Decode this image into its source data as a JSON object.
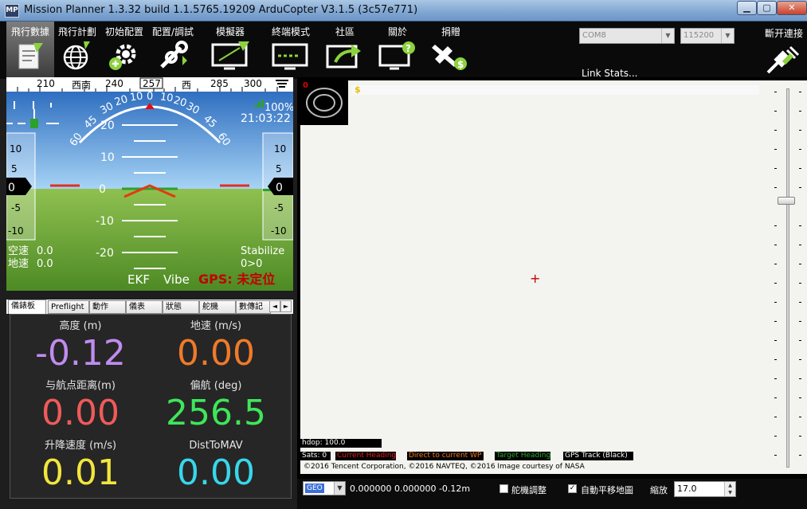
{
  "window": {
    "icon_text": "MP",
    "title": "Mission Planner 1.3.32 build 1.1.5765.19209 ArduCopter V3.1.5 (3c57e771)",
    "min": "▁",
    "max": "▢",
    "close": "✕"
  },
  "menu": [
    {
      "label": "飛行數據",
      "icon": "flight-data-icon"
    },
    {
      "label": "飛行計劃",
      "icon": "flight-plan-globe-icon"
    },
    {
      "label": "初始配置",
      "icon": "initial-setup-gear-icon"
    },
    {
      "label": "配置/調試",
      "icon": "config-tuning-wrench-icon"
    },
    {
      "label": "模擬器",
      "icon": "simulation-monitor-icon"
    },
    {
      "label": "終端模式",
      "icon": "terminal-monitor-icon"
    },
    {
      "label": "社區",
      "icon": "community-share-icon"
    },
    {
      "label": "關於",
      "icon": "help-monitor-icon"
    },
    {
      "label": "捐贈",
      "icon": "donate-plane-icon"
    }
  ],
  "connection": {
    "port": "COM8",
    "baud": "115200",
    "link_stats": "Link Stats...",
    "disconnect": "斷开連接"
  },
  "hud": {
    "heading_ticks": [
      "210",
      "西南",
      "240",
      "257",
      "西",
      "285",
      "300"
    ],
    "pitch_labels": [
      "20",
      "10",
      "0",
      "-10",
      "-20"
    ],
    "roll_labels": [
      "60",
      "45",
      "30",
      "20",
      "10",
      "0",
      "10",
      "20",
      "30",
      "45",
      "60"
    ],
    "speed_tape": [
      "10",
      "5",
      "0",
      "-5",
      "-10"
    ],
    "alt_tape": [
      "10",
      "5",
      "0",
      "-5",
      "-10"
    ],
    "speed_current": "0",
    "alt_current": "0",
    "battery_pct": "100%",
    "time": "21:03:22",
    "airspeed_label": "空速",
    "airspeed_value": "0.0",
    "groundspeed_label": "地速",
    "groundspeed_value": "0.0",
    "mode": "Stabilize",
    "wp": "0>0",
    "ekf": "EKF",
    "vibe": "Vibe",
    "gps": "GPS: 未定位",
    "colors": {
      "sky": "#5aa7e3",
      "ground": "#6fa63a",
      "gps_warn": "#c00000"
    }
  },
  "tabs": [
    "儀錶板",
    "Preflight",
    "動作",
    "儀表",
    "狀態",
    "舵機",
    "數傳記"
  ],
  "tab_scroll": {
    "left": "◄",
    "right": "►"
  },
  "quick": [
    {
      "label": "高度 (m)",
      "value": "-0.12",
      "color": "#c08cf0"
    },
    {
      "label": "地速 (m/s)",
      "value": "0.00",
      "color": "#f07a2a"
    },
    {
      "label": "与航点距离(m)",
      "value": "0.00",
      "color": "#f05a5a"
    },
    {
      "label": "偏航 (deg)",
      "value": "256.5",
      "color": "#3ee65a"
    },
    {
      "label": "升降速度 (m/s)",
      "value": "0.01",
      "color": "#f2e63c"
    },
    {
      "label": "DistToMAV",
      "value": "0.00",
      "color": "#38d6ea"
    }
  ],
  "map": {
    "indicator_zero": "0",
    "dollar": "$",
    "crosshair": "+",
    "hdop": "hdop: 100.0",
    "legend": [
      {
        "text": "Sats: 0",
        "color": "#ffffff"
      },
      {
        "text": "Current Heading",
        "color": "#e02020"
      },
      {
        "text": "Direct to current WP",
        "color": "#f07820"
      },
      {
        "text": "Target Heading",
        "color": "#2ea82e"
      },
      {
        "text": "GPS Track (Black)",
        "color": "#ffffff"
      }
    ],
    "copyright": "©2016 Tencent Corporation, ©2016 NAVTEQ, ©2016 Image courtesy of NASA"
  },
  "bottom": {
    "geo": "GEO",
    "coords": "0.000000 0.000000   -0.12m",
    "tuning_label": "舵機調整",
    "tuning_checked": false,
    "autopan_label": "自動平移地圖",
    "autopan_checked": true,
    "zoom_label": "縮放",
    "zoom_value": "17.0",
    "check_mark": "✓"
  }
}
